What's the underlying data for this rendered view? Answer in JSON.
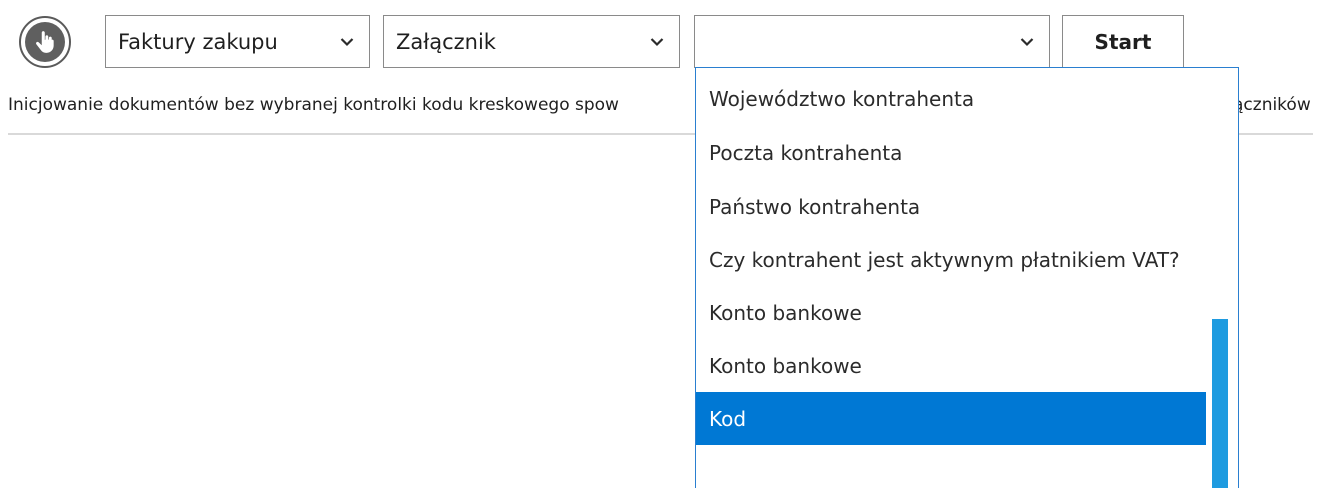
{
  "toolbar": {
    "select1_value": "Faktury zakupu",
    "select2_value": "Załącznik",
    "select3_value": "",
    "start_label": "Start"
  },
  "info_text": "Inicjowanie dokumentów bez wybranej kontrolki kodu kreskowego spow",
  "info_text_tail": "ączników",
  "dropdown": {
    "items": [
      "Województwo kontrahenta",
      "Poczta kontrahenta",
      "Państwo kontrahenta",
      "Czy kontrahent jest aktywnym płatnikiem VAT?",
      "Konto bankowe",
      "Konto bankowe",
      "Kod"
    ],
    "selected_index": 6
  },
  "colors": {
    "accent": "#0078d4",
    "scrollbar": "#1e9be0",
    "border": "#8a8a8a"
  },
  "icons": {
    "hand_button": "hand-pointer-icon",
    "chevron": "chevron-down-icon"
  }
}
